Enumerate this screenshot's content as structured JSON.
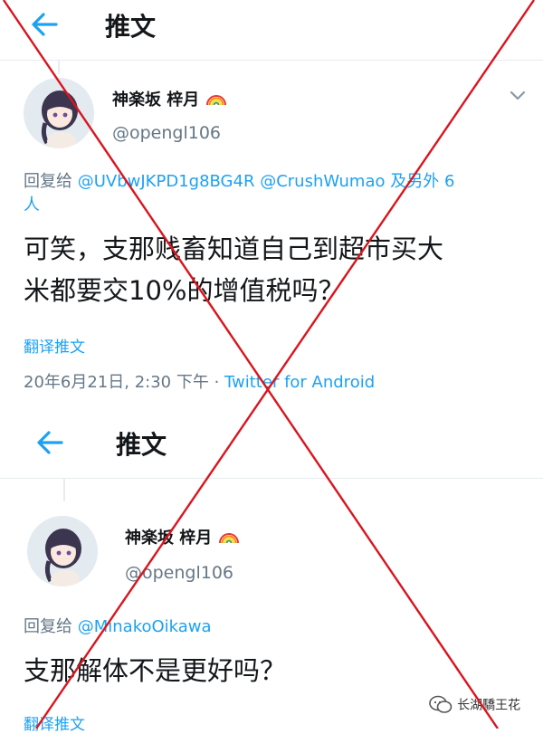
{
  "screen1": {
    "header": {
      "title": "推文"
    },
    "tweet": {
      "display_name": "神楽坂 梓月",
      "handle": "@opengl106",
      "reply_prefix": "回复给",
      "reply_users": "@UVbwJKPD1g8BG4R @CrushWumao",
      "reply_suffix": "及另外 6",
      "reply_suffix2": "人",
      "text_line1": "可笑，支那贱畜知道自己到超市买大",
      "text_line2": "米都要交10%的增值税吗？",
      "translate": "翻译推文",
      "timestamp": "20年6月21日, 2:30 下午 · ",
      "source": "Twitter for Android"
    }
  },
  "screen2": {
    "header": {
      "title": "推文"
    },
    "tweet": {
      "display_name": "神楽坂 梓月",
      "handle": "@opengl106",
      "reply_prefix": "回复给",
      "reply_users": "@MinakoOikawa",
      "text_line1": "支那解体不是更好吗？",
      "translate": "翻译推文"
    }
  },
  "watermark": {
    "text": "长湖驕王花"
  },
  "colors": {
    "accent": "#1da1f2",
    "secondary_text": "#657786",
    "cross": "#d9151e"
  },
  "icons": [
    "back-arrow-icon",
    "chevron-down-icon",
    "rainbow-emoji-icon",
    "wechat-icon"
  ]
}
